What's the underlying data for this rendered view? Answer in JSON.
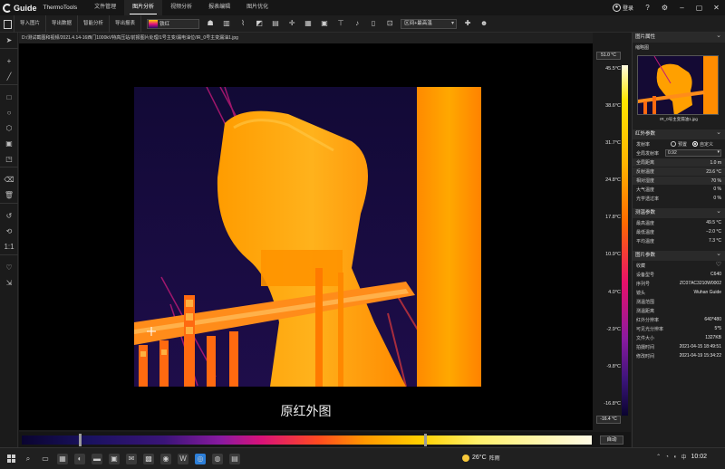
{
  "titlebar": {
    "logo": "Guide",
    "app_name": "ThermoTools",
    "menu": [
      "文件管理",
      "图片分析",
      "视频分析",
      "报表编辑",
      "图片优化"
    ],
    "active_menu": "图片分析",
    "login": "登录"
  },
  "toolbar": {
    "buttons": [
      "导入图片",
      "导出数据",
      "智能分析",
      "导出报表"
    ],
    "palette": "铁红",
    "mode": "区间+最高温"
  },
  "path": "D:/测试截图和视频/2021.4.14-16西门1000kV特高压站/前报图片处理/1号主变/漏电油位/IR_0号主变漏油1.jpg",
  "scale": {
    "max_label": "51.0 °C",
    "min_label": "-16.4 °C",
    "ticks": [
      "45.5°C",
      "38.6°C",
      "31.7°C",
      "24.8°C",
      "17.8°C",
      "10.9°C",
      "4.0°C",
      "-2.9°C",
      "-9.8°C",
      "-16.8°C"
    ]
  },
  "caption": "原红外图",
  "right_panel": {
    "header": "图片属性",
    "thumb_title": "缩略图",
    "thumb_name": "IR_0号主变漏油1.jpg",
    "ir_params": {
      "title": "红外参数",
      "emissivity_label": "发射率",
      "radio_a": "预置",
      "radio_b": "自定义",
      "material_label": "全局发射率",
      "material_value": "0.92",
      "rows": [
        {
          "k": "全局距离",
          "v": "1.0 m"
        },
        {
          "k": "反射温度",
          "v": "23.6 °C"
        },
        {
          "k": "相对湿度",
          "v": "70 %"
        },
        {
          "k": "大气温度",
          "v": "0 %"
        },
        {
          "k": "光学透过率",
          "v": "0 %"
        }
      ]
    },
    "temp": {
      "title": "测温参数",
      "rows": [
        {
          "k": "最高温度",
          "v": "49.5 °C"
        },
        {
          "k": "最低温度",
          "v": "−2.0 °C"
        },
        {
          "k": "平均温度",
          "v": "7.3 °C"
        }
      ]
    },
    "image": {
      "title": "图片参数",
      "favorite": "收藏",
      "rows": [
        {
          "k": "设备型号",
          "v": "C640"
        },
        {
          "k": "序列号",
          "v": "ZC07AC3210W0002"
        },
        {
          "k": "镜头",
          "v": "Wuhan Guide"
        },
        {
          "k": "测温范围",
          "v": ""
        },
        {
          "k": "测温距离",
          "v": ""
        },
        {
          "k": "红外分辨率",
          "v": "640*480"
        },
        {
          "k": "可见光分辨率",
          "v": "5*5"
        },
        {
          "k": "文件大小",
          "v": "1327KB"
        },
        {
          "k": "拍摄时间",
          "v": "2021-04-15 18:49:51"
        },
        {
          "k": "修改时间",
          "v": "2021-04-19 15:34:22"
        }
      ]
    }
  },
  "histbar": {
    "auto_label": "自动"
  },
  "taskbar": {
    "temp": "26°C",
    "condition": "阵雨",
    "lang": "中",
    "time": "10:02"
  },
  "colors": {
    "accent": "#2d7fd8",
    "bg": "#1b1b1b",
    "hot": "#ffa000",
    "cold": "#140a34"
  }
}
